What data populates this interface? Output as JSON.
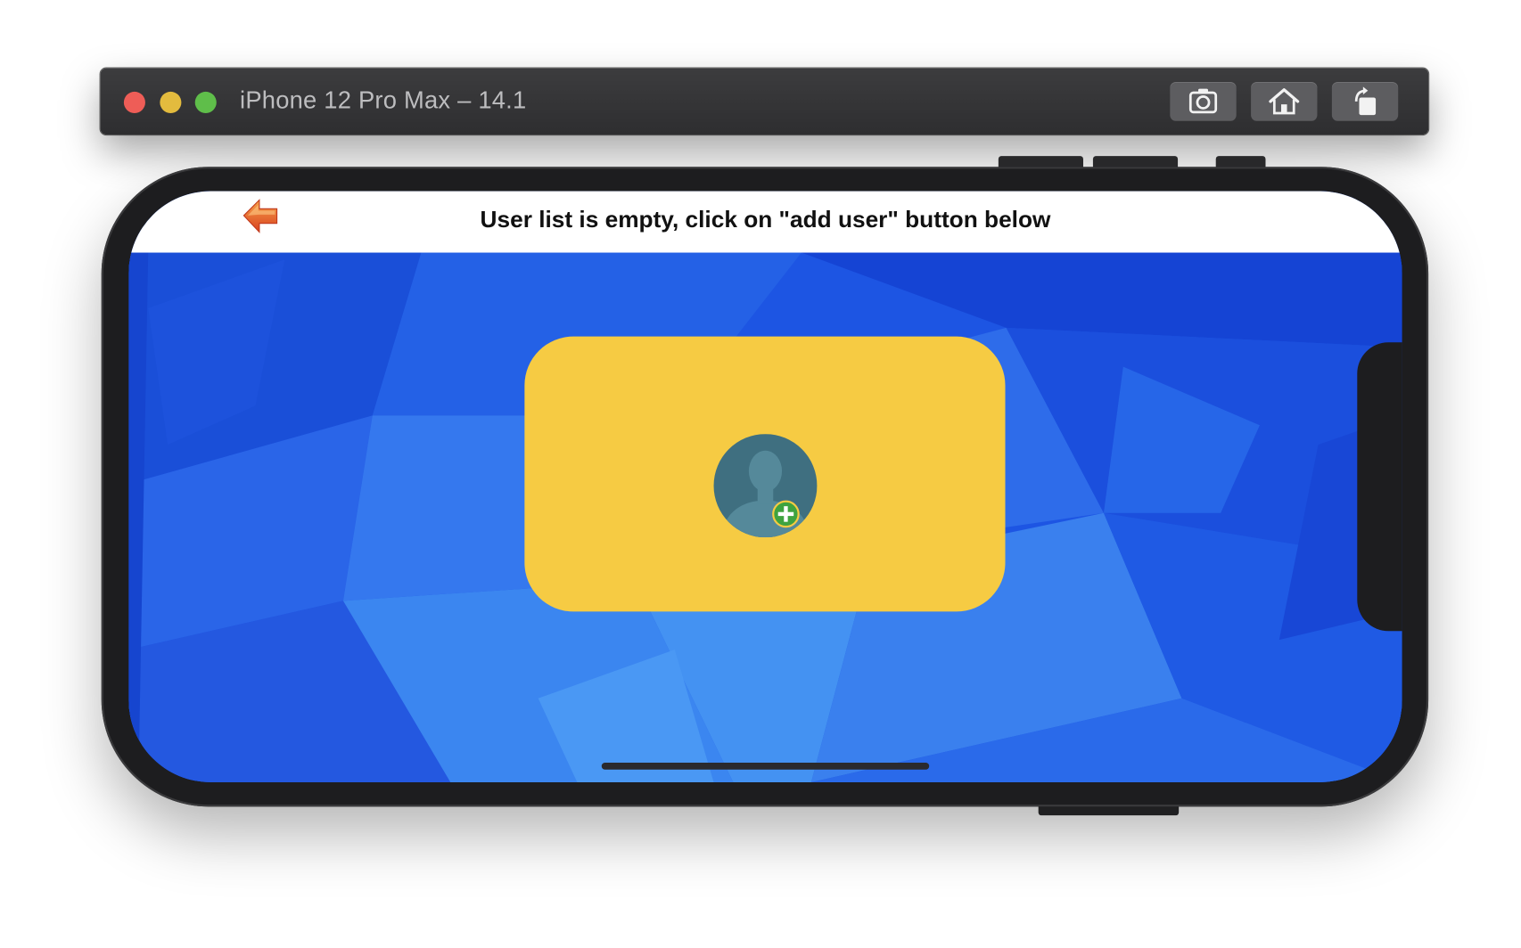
{
  "window": {
    "title": "iPhone 12 Pro Max – 14.1",
    "traffic_lights": [
      "close",
      "minimize",
      "zoom"
    ],
    "toolbar": {
      "buttons": [
        {
          "name": "screenshot",
          "icon": "camera-icon"
        },
        {
          "name": "home",
          "icon": "home-icon"
        },
        {
          "name": "rotate",
          "icon": "rotate-icon"
        }
      ]
    }
  },
  "app": {
    "navbar": {
      "back_icon": "back-arrow-icon",
      "message": "User list is empty, click on \"add user\" button below"
    },
    "add_user_button": {
      "icon": "add-user-icon"
    }
  },
  "colors": {
    "background_blue": "#1f56e0",
    "card_yellow": "#f6cb43",
    "avatar_teal": "#4d7d8c",
    "plus_green": "#3fa33f",
    "back_arrow_orange": "#e2552c"
  }
}
